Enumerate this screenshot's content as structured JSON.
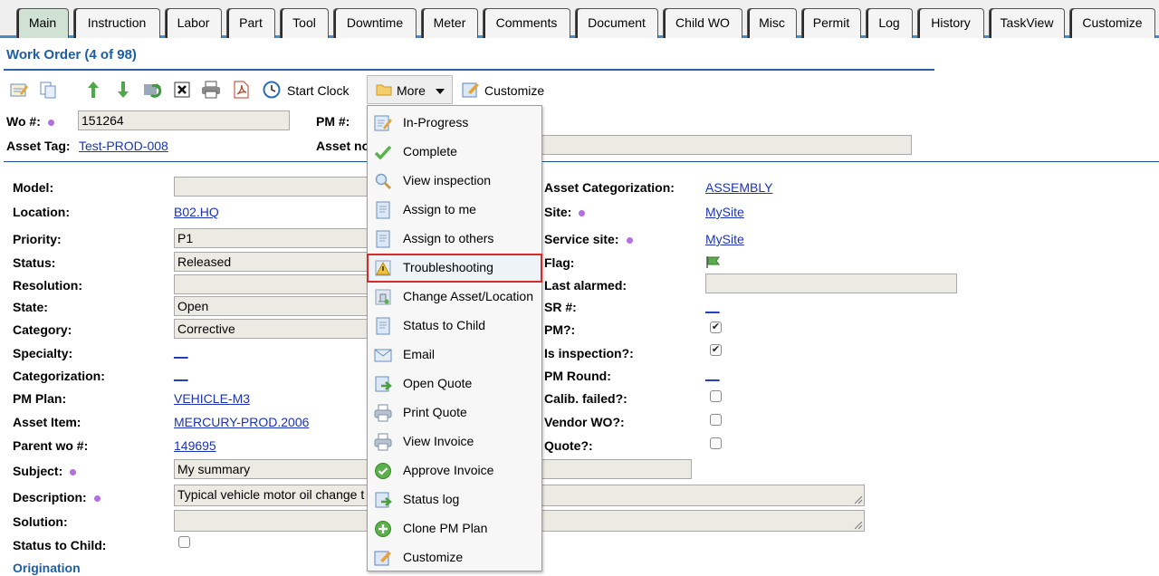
{
  "tabs": [
    "Main",
    "Instruction",
    "Labor",
    "Part",
    "Tool",
    "Downtime",
    "Meter",
    "Comments",
    "Document",
    "Child WO",
    "Misc",
    "Permit",
    "Log",
    "History",
    "TaskView",
    "Customize"
  ],
  "title": "Work Order (4 of 98)",
  "toolbar": {
    "start_clock": "Start Clock",
    "more": "More",
    "customize": "Customize"
  },
  "header": {
    "wo_label": "Wo #:",
    "wo_value": "151264",
    "pm_label": "PM #:",
    "asset_tag_label": "Asset Tag:",
    "asset_tag_value": "Test-PROD-008",
    "asset_no_label": "Asset no"
  },
  "left": {
    "model_label": "Model:",
    "model_value": "",
    "location_label": "Location:",
    "location_value": "B02.HQ",
    "priority_label": "Priority:",
    "priority_value": "P1",
    "status_label": "Status:",
    "status_value": "Released",
    "resolution_label": "Resolution:",
    "resolution_value": "",
    "state_label": "State:",
    "state_value": "Open",
    "category_label": "Category:",
    "category_value": "Corrective",
    "specialty_label": "Specialty:",
    "specialty_value": "__",
    "categorization_label": "Categorization:",
    "categorization_value": "__",
    "pmplan_label": "PM Plan:",
    "pmplan_value": "VEHICLE-M3",
    "assetitem_label": "Asset Item:",
    "assetitem_value": "MERCURY-PROD.2006",
    "parentwo_label": "Parent wo #:",
    "parentwo_value": "149695",
    "subject_label": "Subject:",
    "subject_value": "My summary",
    "description_label": "Description:",
    "description_value": "Typical vehicle motor oil change t",
    "solution_label": "Solution:",
    "solution_value": "",
    "statuschild_label": "Status to Child:",
    "origination_label": "Origination"
  },
  "right": {
    "assetcat_label": "Asset Categorization:",
    "assetcat_value": "ASSEMBLY",
    "site_label": "Site:",
    "site_value": "MySite",
    "servicesite_label": "Service site:",
    "servicesite_value": "MySite",
    "flag_label": "Flag:",
    "lastalarmed_label": "Last alarmed:",
    "sr_label": "SR #:",
    "sr_value": "__",
    "pm_label": "PM?:",
    "pm_checked": true,
    "isinspection_label": "Is inspection?:",
    "isinspection_checked": true,
    "pmround_label": "PM Round:",
    "pmround_value": "__",
    "calib_label": "Calib. failed?:",
    "calib_checked": false,
    "vendorwo_label": "Vendor WO?:",
    "vendorwo_checked": false,
    "quote_label": "Quote?:",
    "quote_checked": false
  },
  "menu": [
    {
      "label": "In-Progress",
      "icon": "edit-note-icon"
    },
    {
      "label": "Complete",
      "icon": "checkmark-icon"
    },
    {
      "label": "View inspection",
      "icon": "magnifier-icon"
    },
    {
      "label": "Assign to me",
      "icon": "document-icon"
    },
    {
      "label": "Assign to others",
      "icon": "document-icon"
    },
    {
      "label": "Troubleshooting",
      "icon": "warning-icon"
    },
    {
      "label": "Change Asset/Location",
      "icon": "asset-icon"
    },
    {
      "label": "Status to Child",
      "icon": "document-icon"
    },
    {
      "label": "Email",
      "icon": "envelope-icon"
    },
    {
      "label": "Open Quote",
      "icon": "forward-arrow-icon"
    },
    {
      "label": "Print Quote",
      "icon": "printer-icon"
    },
    {
      "label": "View Invoice",
      "icon": "printer-icon"
    },
    {
      "label": "Approve Invoice",
      "icon": "green-check-circle-icon"
    },
    {
      "label": "Status log",
      "icon": "forward-arrow-icon"
    },
    {
      "label": "Clone PM Plan",
      "icon": "green-plus-circle-icon"
    },
    {
      "label": "Customize",
      "icon": "customize-icon"
    }
  ]
}
